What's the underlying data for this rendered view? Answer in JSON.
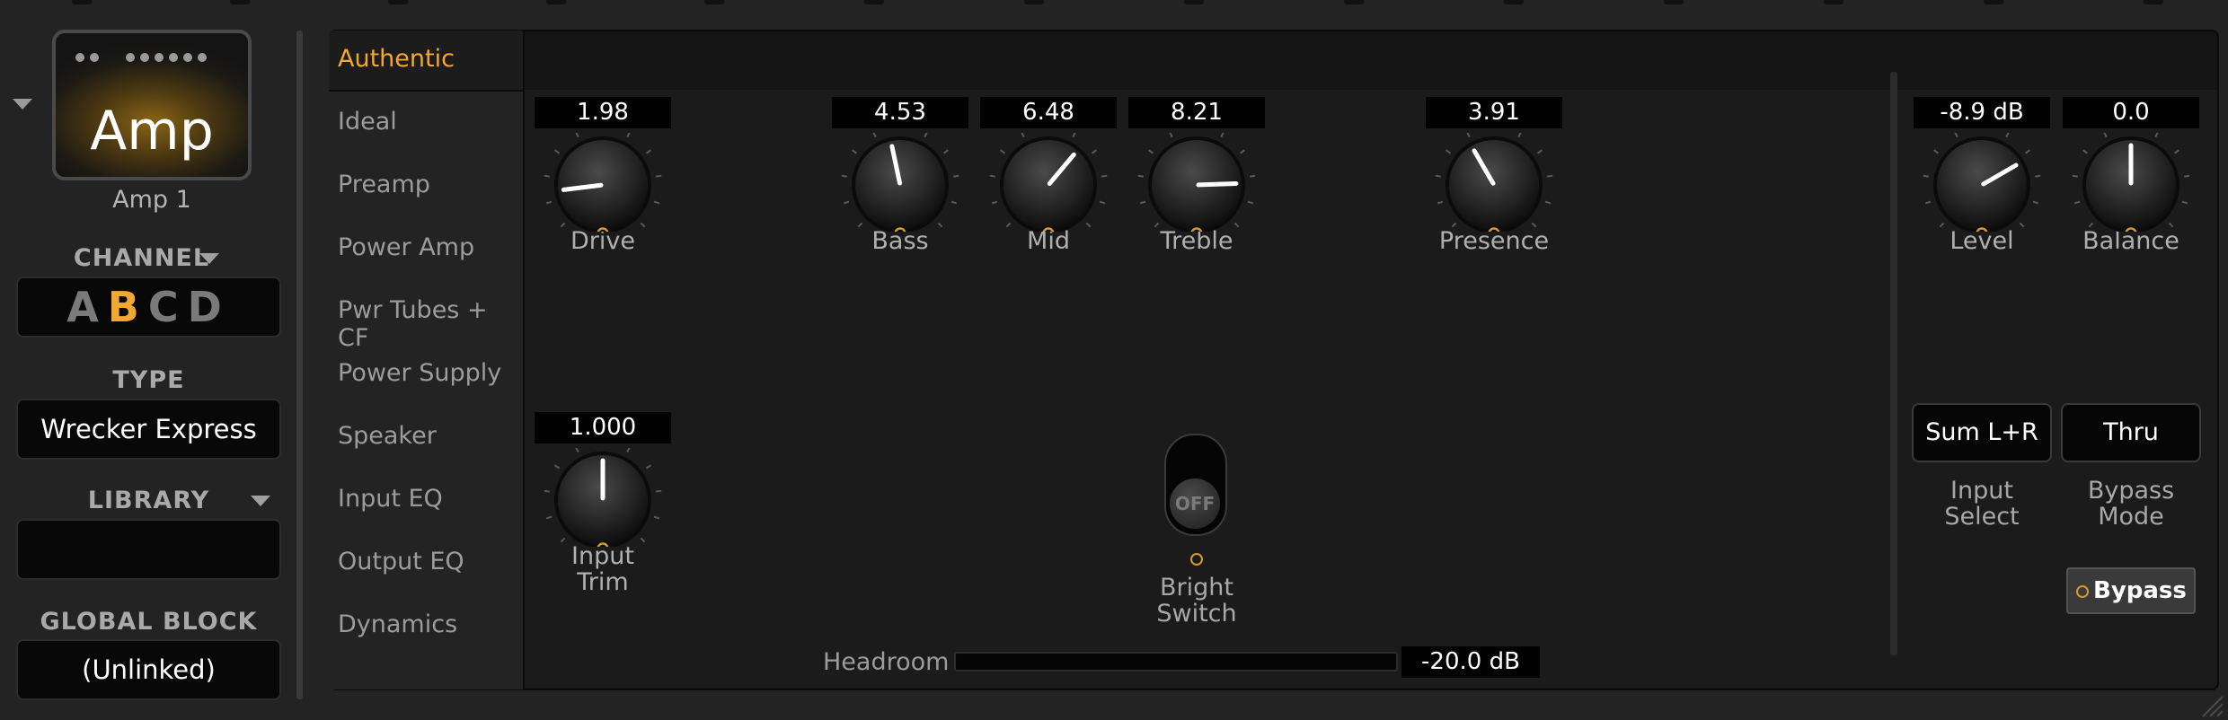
{
  "left_panel": {
    "block_name": "Amp",
    "instance_name": "Amp 1",
    "channel_label": "CHANNEL",
    "channels": [
      "A",
      "B",
      "C",
      "D"
    ],
    "active_channel": "B",
    "type_label": "TYPE",
    "type_value": "Wrecker Express",
    "library_label": "LIBRARY",
    "library_value": "",
    "global_block_label": "GLOBAL BLOCK",
    "global_block_value": "(Unlinked)"
  },
  "tabs": {
    "active": "Authentic",
    "items": [
      "Ideal",
      "Preamp",
      "Power Amp",
      "Pwr Tubes + CF",
      "Power Supply",
      "Speaker",
      "Input EQ",
      "Output EQ",
      "Dynamics"
    ]
  },
  "knobs": {
    "drive": {
      "label": "Drive",
      "value": "1.98"
    },
    "bass": {
      "label": "Bass",
      "value": "4.53"
    },
    "mid": {
      "label": "Mid",
      "value": "6.48"
    },
    "treble": {
      "label": "Treble",
      "value": "8.21"
    },
    "presence": {
      "label": "Presence",
      "value": "3.91"
    },
    "level": {
      "label": "Level",
      "value": "-8.9 dB"
    },
    "balance": {
      "label": "Balance",
      "value": "0.0"
    },
    "input_trim": {
      "label_line1": "Input",
      "label_line2": "Trim",
      "value": "1.000"
    }
  },
  "bright_switch": {
    "state": "OFF",
    "label_line1": "Bright",
    "label_line2": "Switch"
  },
  "input_select": {
    "value": "Sum L+R",
    "label_line1": "Input",
    "label_line2": "Select"
  },
  "bypass_mode": {
    "value": "Thru",
    "label_line1": "Bypass",
    "label_line2": "Mode"
  },
  "bypass_button": {
    "label": "Bypass"
  },
  "headroom": {
    "label": "Headroom",
    "value": "-20.0 dB"
  },
  "colors": {
    "accent": "#f0a830",
    "indicator_ring": "#d39a2c"
  }
}
